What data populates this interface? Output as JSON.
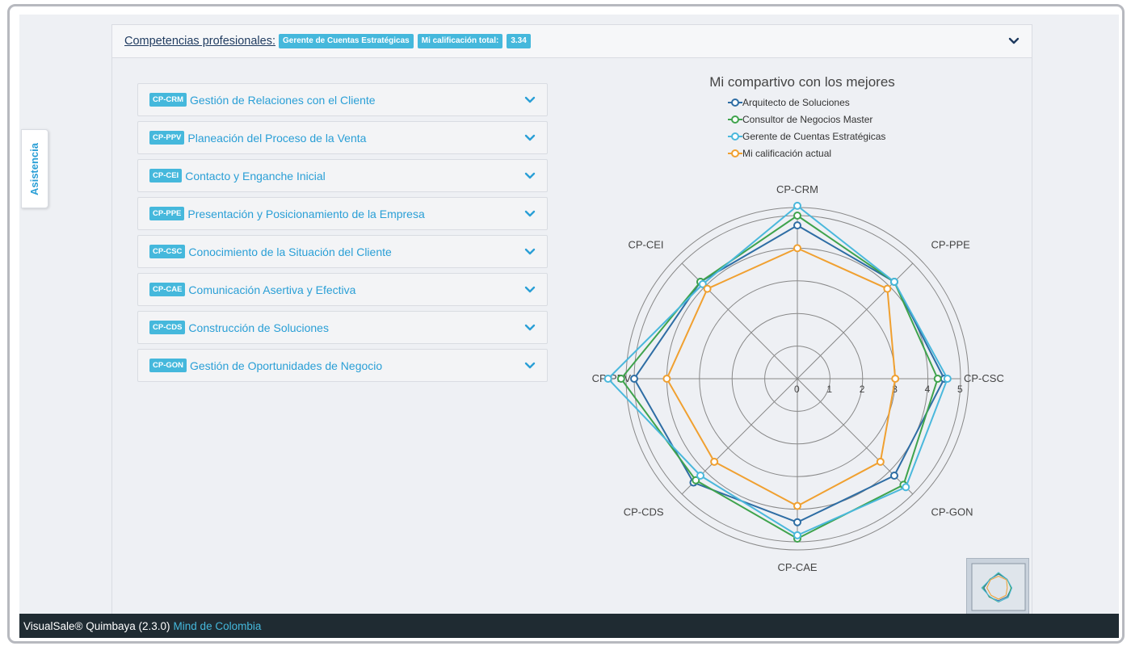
{
  "side_tab": {
    "label": "Asistencia"
  },
  "header": {
    "title": "Competencias profesionales:",
    "role_badge": "Gerente de Cuentas Estratégicas",
    "score_label": "Mi calificación total:",
    "score_value": "3.34"
  },
  "competencies": [
    {
      "code": "CP-CRM",
      "label": "Gestión de Relaciones con el Cliente"
    },
    {
      "code": "CP-PPV",
      "label": "Planeación del Proceso de la Venta"
    },
    {
      "code": "CP-CEI",
      "label": "Contacto y Enganche Inicial"
    },
    {
      "code": "CP-PPE",
      "label": "Presentación y Posicionamiento de la Empresa"
    },
    {
      "code": "CP-CSC",
      "label": "Conocimiento de la Situación del Cliente"
    },
    {
      "code": "CP-CAE",
      "label": "Comunicación Asertiva y Efectiva"
    },
    {
      "code": "CP-CDS",
      "label": "Construcción de Soluciones"
    },
    {
      "code": "CP-GON",
      "label": "Gestión de Oportunidades de Negocio"
    }
  ],
  "chart_data": {
    "type": "radar",
    "title": "Mi compartivo con los mejores",
    "axes": [
      "CP-CRM",
      "CP-PPE",
      "CP-CSC",
      "CP-GON",
      "CP-CAE",
      "CP-CDS",
      "CP-PPV",
      "CP-CEI"
    ],
    "rlim": [
      0,
      5
    ],
    "ticks": [
      0,
      1,
      2,
      3,
      4,
      5
    ],
    "legend_position": "top",
    "series": [
      {
        "name": "Arquitecto de Soluciones",
        "color": "#2e6da4",
        "values": [
          4.7,
          4.2,
          4.5,
          4.2,
          4.4,
          4.5,
          5.0,
          4.2
        ]
      },
      {
        "name": "Consultor de Negocios Master",
        "color": "#3fa34d",
        "values": [
          5.0,
          4.2,
          4.3,
          4.6,
          4.9,
          4.4,
          5.4,
          4.2
        ]
      },
      {
        "name": "Gerente de Cuentas Estratégicas",
        "color": "#4ab8dc",
        "values": [
          5.3,
          4.2,
          4.6,
          4.7,
          4.8,
          4.2,
          5.8,
          4.1
        ]
      },
      {
        "name": "Mi calificación actual",
        "color": "#f0a030",
        "values": [
          4.0,
          3.9,
          3.0,
          3.6,
          3.9,
          3.6,
          4.0,
          3.9
        ]
      }
    ]
  }
}
